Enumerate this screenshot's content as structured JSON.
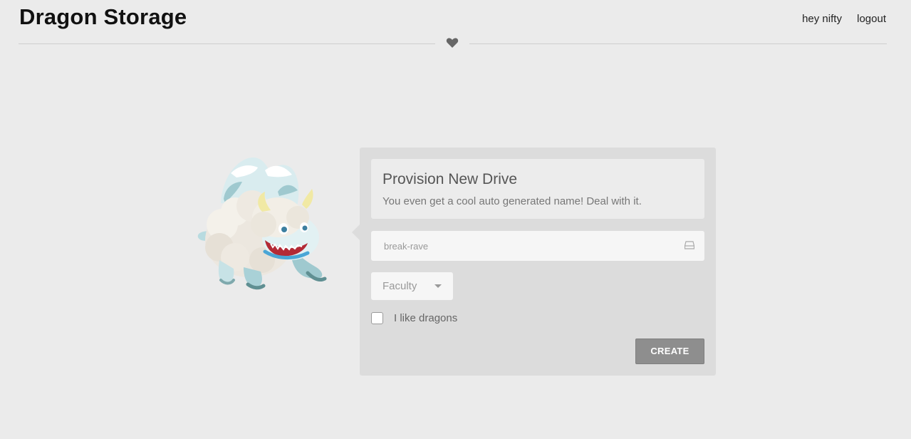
{
  "header": {
    "brand": "Dragon Storage",
    "nav": {
      "greeting": "hey nifty",
      "logout": "logout"
    },
    "divider_icon": "heart-icon"
  },
  "dragon_image": "dragon-illustration",
  "form": {
    "title": "Provision New Drive",
    "subtitle": "You even get a cool auto generated name! Deal with it.",
    "drive_name": {
      "value": "break-rave",
      "icon": "drive-icon"
    },
    "role_select": {
      "selected": "Faculty"
    },
    "checkbox": {
      "label": "I like dragons",
      "checked": false
    },
    "submit_label": "CREATE"
  },
  "colors": {
    "background": "#ebebeb",
    "panel": "#dcdcdc",
    "button": "#8e8e8e"
  }
}
